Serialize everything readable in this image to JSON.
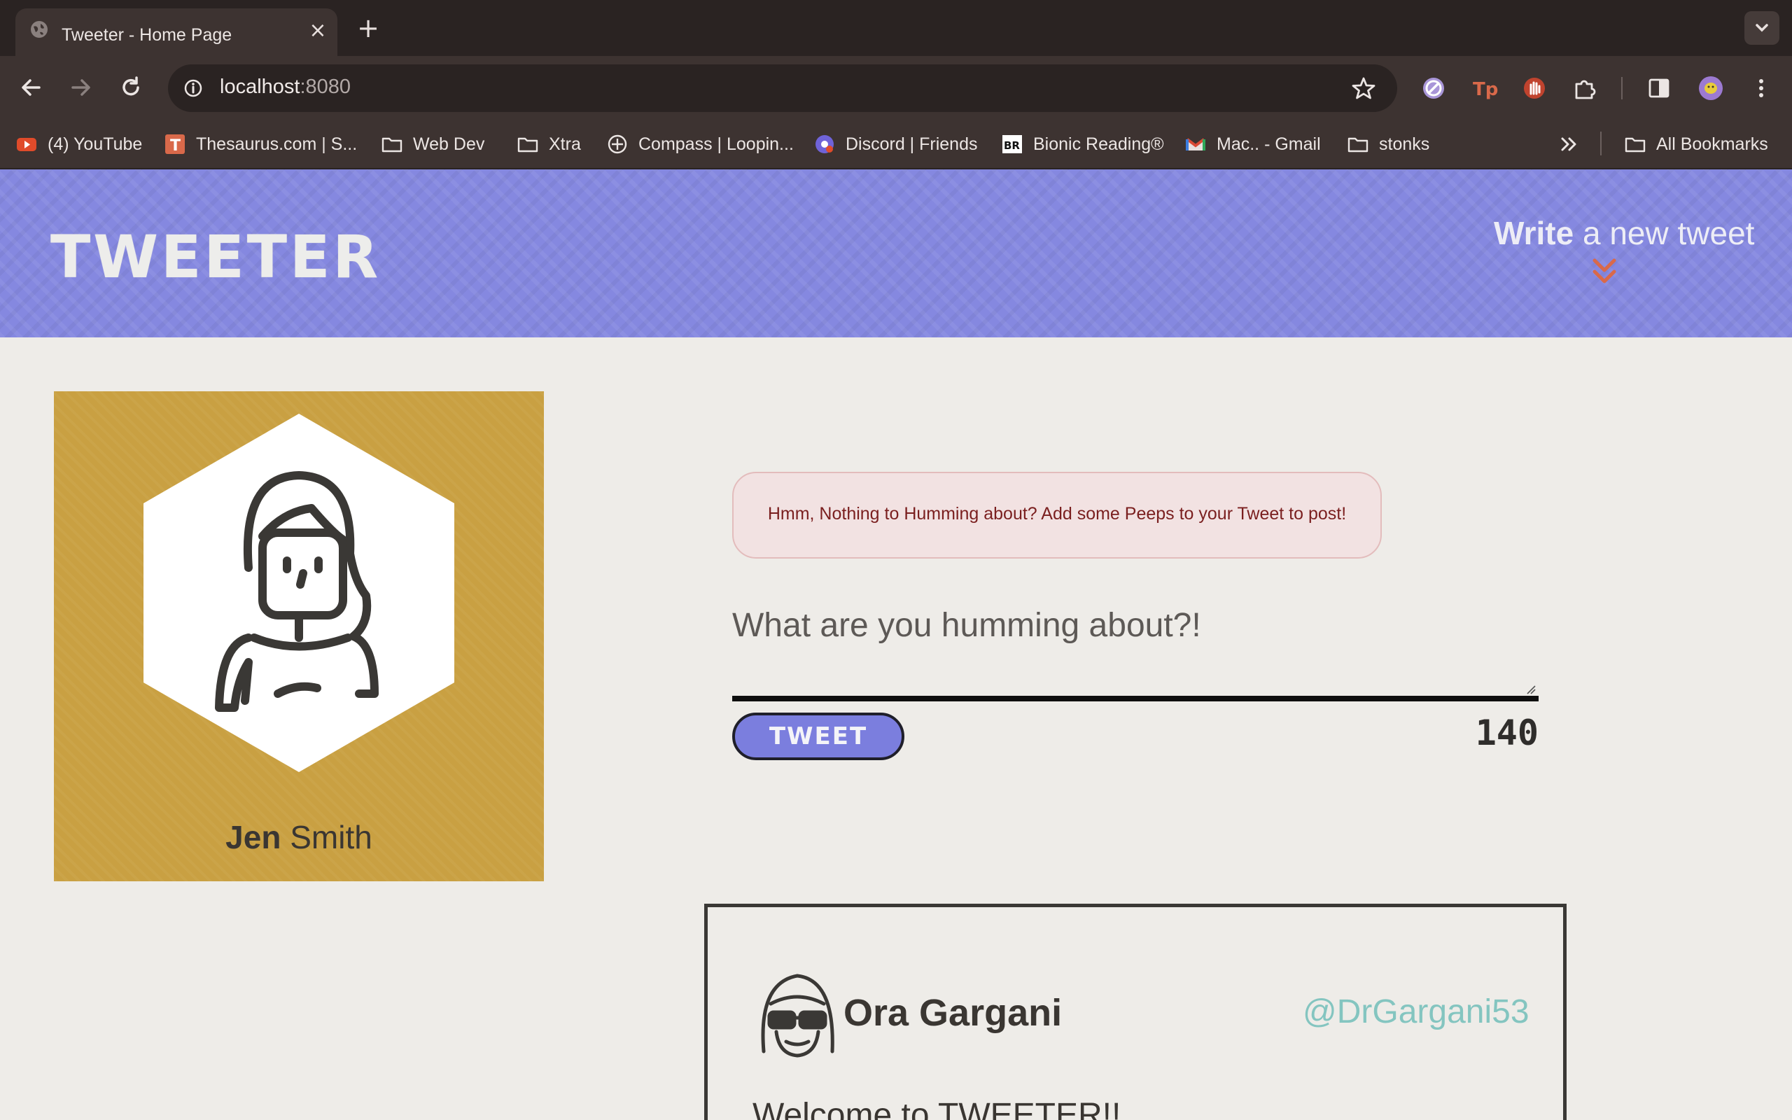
{
  "browser": {
    "tab_title": "Tweeter - Home Page",
    "url_host": "localhost",
    "url_port": ":8080",
    "bookmarks": [
      {
        "label": "(4) YouTube",
        "icon": "youtube-icon"
      },
      {
        "label": "Thesaurus.com | S...",
        "icon": "thesaurus-icon"
      },
      {
        "label": "Web Dev",
        "icon": "folder-icon"
      },
      {
        "label": "Xtra",
        "icon": "folder-icon"
      },
      {
        "label": "Compass | Loopin...",
        "icon": "compass-icon"
      },
      {
        "label": "Discord | Friends",
        "icon": "discord-icon"
      },
      {
        "label": "Bionic Reading®",
        "icon": "bionic-reading-icon"
      },
      {
        "label": "Mac.. - Gmail",
        "icon": "gmail-icon"
      },
      {
        "label": "stonks",
        "icon": "folder-icon"
      }
    ],
    "all_bookmarks_label": "All Bookmarks"
  },
  "header": {
    "logo": "TWEETER",
    "write_bold": "Write",
    "write_rest": " a new tweet"
  },
  "profile": {
    "first_name": "Jen",
    "last_name": " Smith"
  },
  "composer": {
    "error_message": "Hmm, Nothing to Humming about? Add some Peeps to your Tweet to post!",
    "placeholder": "What are you humming about?!",
    "button_label": "TWEET",
    "counter": "140"
  },
  "tweet": {
    "name": "Ora Gargani",
    "handle": "@DrGargani53",
    "content": "Welcome to TWEETER!!"
  },
  "colors": {
    "header_bg": "#8588e0",
    "profile_bg": "#c9a042",
    "accent_chevron": "#d9694a",
    "handle": "#84c5c0",
    "error_text": "#7a1f1f"
  }
}
